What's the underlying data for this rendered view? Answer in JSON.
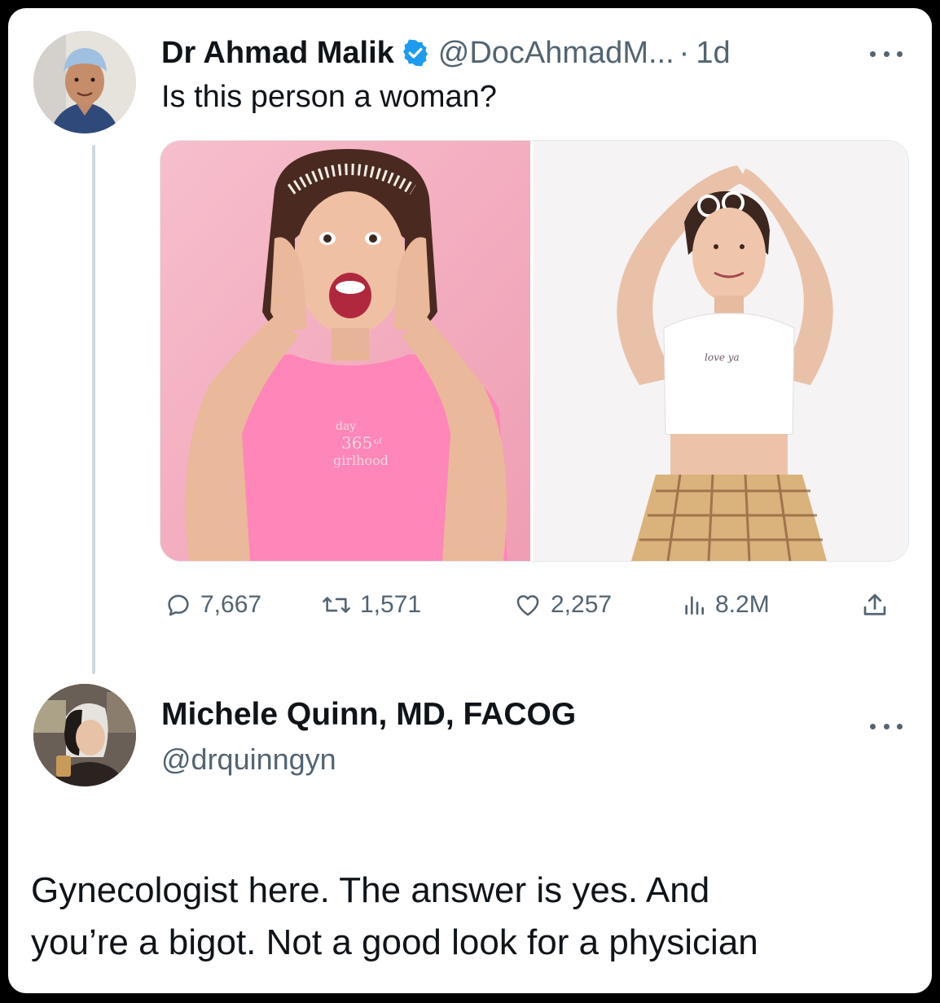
{
  "tweet": {
    "display_name": "Dr Ahmad Malik",
    "handle": "@DocAhmadM...",
    "separator": "·",
    "time": "1d",
    "text": "Is this person a woman?",
    "images": [
      {
        "shirt_text_lines": [
          "day",
          "365",
          "of",
          "girlhood"
        ]
      },
      {
        "shirt_text": "love ya"
      }
    ],
    "metrics": {
      "replies": "7,667",
      "retweets": "1,571",
      "likes": "2,257",
      "views": "8.2M"
    }
  },
  "reply": {
    "display_name": "Michele Quinn, MD, FACOG",
    "handle": "@drquinngyn",
    "text_line1": "Gynecologist here. The answer is yes. And",
    "text_line2": "you’re a bigot. Not a good look for a physician"
  },
  "colors": {
    "text_primary": "#0f1419",
    "text_secondary": "#536471",
    "verified_blue": "#1d9bf0",
    "thread_line": "#cfd9de",
    "pink_background": "#f3a9bd",
    "pink_shirt": "#ff86b8"
  },
  "icons": [
    "verified-badge-icon",
    "more-icon",
    "reply-icon",
    "retweet-icon",
    "like-icon",
    "views-icon",
    "share-icon"
  ]
}
